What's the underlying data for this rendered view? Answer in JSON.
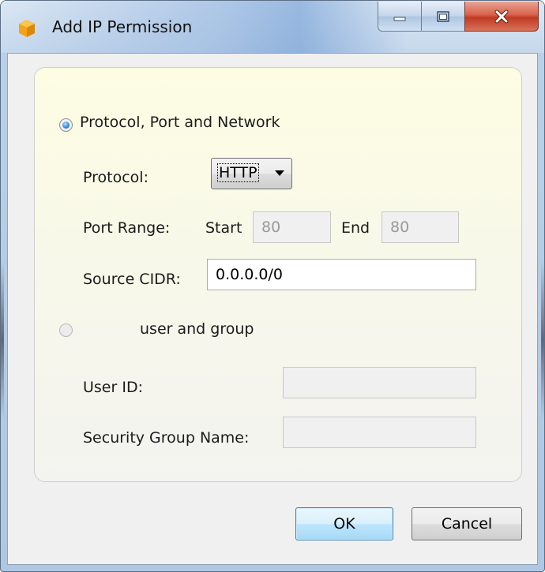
{
  "window": {
    "title": "Add IP Permission"
  },
  "options": {
    "network_option_label": "Protocol, Port and Network",
    "network_option_selected": true,
    "group_option_label": "user and group",
    "group_option_selected": false
  },
  "protocol": {
    "label": "Protocol:",
    "selected": "HTTP"
  },
  "port_range": {
    "label": "Port Range:",
    "start_label": "Start",
    "start_value": "80",
    "end_label": "End",
    "end_value": "80"
  },
  "source_cidr": {
    "label": "Source CIDR:",
    "value": "0.0.0.0/0"
  },
  "user_id": {
    "label": "User ID:",
    "value": ""
  },
  "security_group": {
    "label": "Security Group Name:",
    "value": ""
  },
  "buttons": {
    "ok": "OK",
    "cancel": "Cancel"
  },
  "icons": {
    "app": "app-icon",
    "minimize": "minimize-icon",
    "maximize": "maximize-icon",
    "close": "close-icon",
    "dropdown": "chevron-down-icon"
  }
}
